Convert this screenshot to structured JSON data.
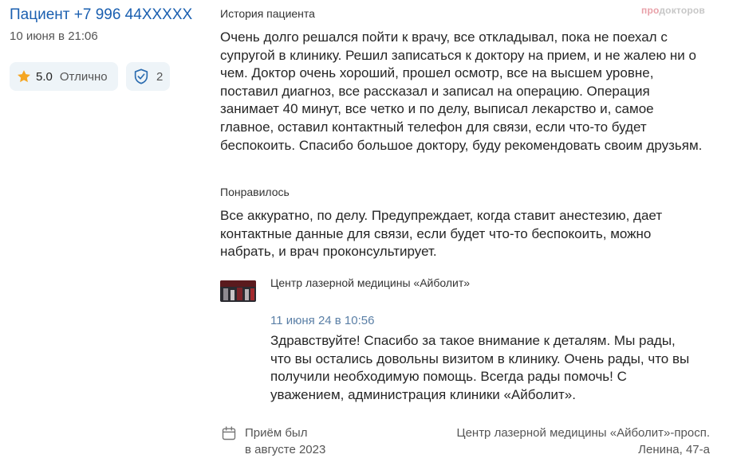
{
  "patient": {
    "name": "Пациент +7 996 44XXXXX",
    "date": "10 июня в 21:06"
  },
  "rating": {
    "score": "5.0",
    "label": "Отлично",
    "star_icon": "star-icon",
    "star_color": "#f5a623"
  },
  "verification": {
    "count": "2",
    "icon": "shield-check-icon",
    "icon_color": "#2b6cb0"
  },
  "logo": {
    "accent_text": "про",
    "rest_text": "докторов"
  },
  "history": {
    "title": "История пациента",
    "text": "Очень долго решался пойти к врачу, все откладывал, пока не поехал с супругой в клинику. Решил записаться к доктору на прием, и не жалею ни о чем. Доктор очень хороший, прошел осмотр, все на высшем уровне, поставил диагноз, все рассказал и записал на операцию. Операция занимает 40 минут, все четко и по делу, выписал лекарство и, самое главное, оставил контактный телефон для связи, если что-то будет беспокоить. Спасибо большое доктору, буду рекомендовать своим друзьям."
  },
  "liked": {
    "title": "Понравилось",
    "text": "Все аккуратно, по делу. Предупреждает, когда ставит анестезию, дает контактные данные для связи, если будет что-то беспокоить, можно набрать, и врач проконсультирует."
  },
  "reply": {
    "clinic_name": "Центр лазерной медицины «Айболит»",
    "date": "11 июня 24 в 10:56",
    "text": "Здравствуйте! Спасибо за такое внимание к деталям. Мы рады, что вы остались довольны визитом в клинику. Очень рады, что вы получили необходимую помощь. Всегда рады помочь! С уважением, администрация клиники «Айболит»."
  },
  "footer": {
    "calendar_icon": "calendar-icon",
    "visit_line1": "Приём был",
    "visit_line2": "в августе 2023",
    "address_line1": "Центр лазерной медицины «Айболит»-просп.",
    "address_line2": "Ленина, 47-а"
  }
}
